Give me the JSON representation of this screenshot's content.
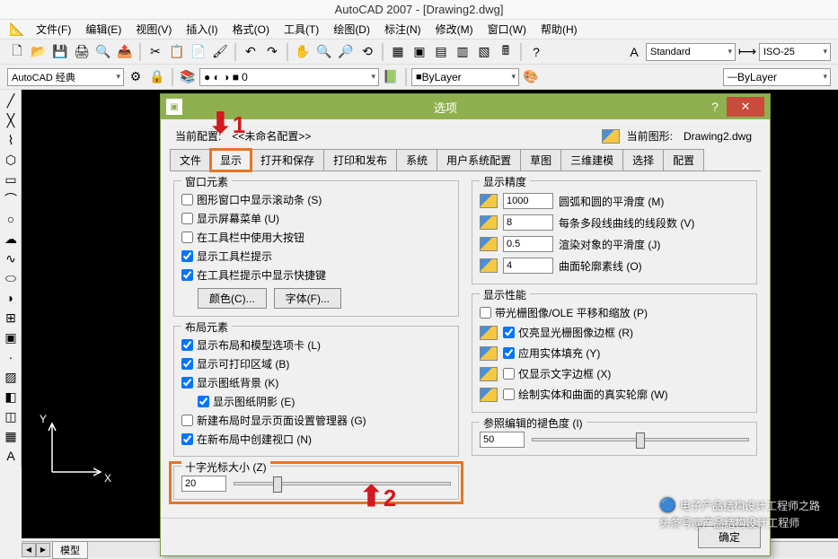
{
  "title": "AutoCAD 2007 - [Drawing2.dwg]",
  "menus": [
    "文件(F)",
    "编辑(E)",
    "视图(V)",
    "插入(I)",
    "格式(O)",
    "工具(T)",
    "绘图(D)",
    "标注(N)",
    "修改(M)",
    "窗口(W)",
    "帮助(H)"
  ],
  "style_combo1": "Standard",
  "style_combo2": "ISO-25",
  "workspace": "AutoCAD 经典",
  "layer_combo": "0",
  "bylayer1": "ByLayer",
  "bylayer2": "ByLayer",
  "layer_icons": "● ◐ ◑ ■",
  "model_tab": "模型",
  "ucs": {
    "x": "X",
    "y": "Y"
  },
  "dialog": {
    "title": "选项",
    "current_cfg_lbl": "当前配置:",
    "current_cfg_val": "<<未命名配置>>",
    "current_dwg_lbl": "当前图形:",
    "current_dwg_val": "Drawing2.dwg",
    "tabs": [
      "文件",
      "显示",
      "打开和保存",
      "打印和发布",
      "系统",
      "用户系统配置",
      "草图",
      "三维建模",
      "选择",
      "配置"
    ],
    "win_elem": {
      "title": "窗口元素",
      "c1": "图形窗口中显示滚动条 (S)",
      "c2": "显示屏幕菜单 (U)",
      "c3": "在工具栏中使用大按钮",
      "c4": "显示工具栏提示",
      "c5": "在工具栏提示中显示快捷键",
      "btn1": "颜色(C)...",
      "btn2": "字体(F)..."
    },
    "layout_elem": {
      "title": "布局元素",
      "c1": "显示布局和模型选项卡 (L)",
      "c2": "显示可打印区域 (B)",
      "c3": "显示图纸背景 (K)",
      "c4": "显示图纸阴影 (E)",
      "c5": "新建布局时显示页面设置管理器 (G)",
      "c6": "在新布局中创建视口 (N)"
    },
    "cross": {
      "title": "十字光标大小 (Z)",
      "val": "20"
    },
    "disp_prec": {
      "title": "显示精度",
      "r1_val": "1000",
      "r1_lbl": "圆弧和圆的平滑度 (M)",
      "r2_val": "8",
      "r2_lbl": "每条多段线曲线的线段数 (V)",
      "r3_val": "0.5",
      "r3_lbl": "渲染对象的平滑度 (J)",
      "r4_val": "4",
      "r4_lbl": "曲面轮廓素线 (O)"
    },
    "disp_perf": {
      "title": "显示性能",
      "c1": "带光栅图像/OLE 平移和缩放 (P)",
      "c2": "仅亮显光栅图像边框 (R)",
      "c3": "应用实体填充 (Y)",
      "c4": "仅显示文字边框 (X)",
      "c5": "绘制实体和曲面的真实轮廓 (W)"
    },
    "ref_fade": {
      "title": "参照编辑的褪色度 (I)",
      "val": "50"
    },
    "ok": "确定"
  },
  "anno1": "1",
  "anno2": "2",
  "watermark1": "电子产品结构设计工程师之路",
  "watermark2": "头条号@产品结构设计工程师"
}
